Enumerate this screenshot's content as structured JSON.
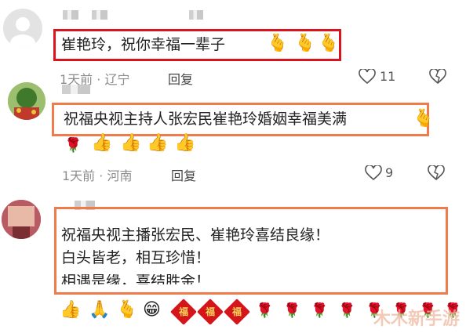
{
  "comments": [
    {
      "text": "崔艳玲，祝你幸福一辈子",
      "time": "1天前",
      "sep": "·",
      "location": "辽宁",
      "reply": "回复",
      "likes": "11",
      "emojis": [
        "🫰",
        "🫰",
        "🫰"
      ]
    },
    {
      "text": "祝福央视主持人张宏民崔艳玲婚姻幸福美满",
      "time": "1天前",
      "sep": "·",
      "location": "河南",
      "reply": "回复",
      "likes": "9",
      "emojis": [
        "🫰",
        "🌹",
        "👍",
        "👍",
        "👍",
        "👍"
      ]
    },
    {
      "line1": "祝福央视主播张宏民、崔艳玲喜结良缘！",
      "line2": "白头皆老，相互珍惜！",
      "line3": "相遇是缘，喜结胜金！",
      "emojis": [
        "👍",
        "🙏",
        "🫰",
        "😁"
      ],
      "fu": "福",
      "roses": [
        "🌹",
        "🌹",
        "🌹",
        "🌹",
        "🌹",
        "🌹",
        "🌹",
        "🌹"
      ]
    }
  ],
  "watermark": "木木新手游",
  "colors": {
    "highlight_red": "#d9141c",
    "highlight_orange": "#f07a4a"
  }
}
